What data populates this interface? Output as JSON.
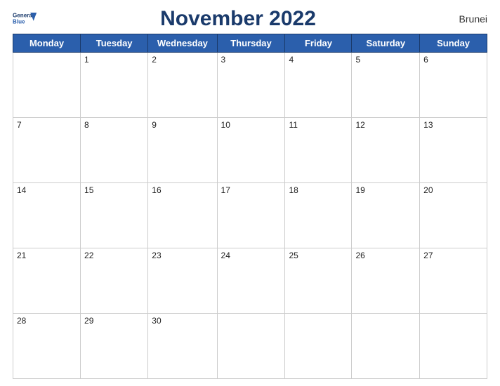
{
  "header": {
    "logo_line1": "General",
    "logo_line2": "Blue",
    "title": "November 2022",
    "country": "Brunei"
  },
  "weekdays": [
    "Monday",
    "Tuesday",
    "Wednesday",
    "Thursday",
    "Friday",
    "Saturday",
    "Sunday"
  ],
  "weeks": [
    [
      null,
      1,
      2,
      3,
      4,
      5,
      6
    ],
    [
      7,
      8,
      9,
      10,
      11,
      12,
      13
    ],
    [
      14,
      15,
      16,
      17,
      18,
      19,
      20
    ],
    [
      21,
      22,
      23,
      24,
      25,
      26,
      27
    ],
    [
      28,
      29,
      30,
      null,
      null,
      null,
      null
    ]
  ]
}
